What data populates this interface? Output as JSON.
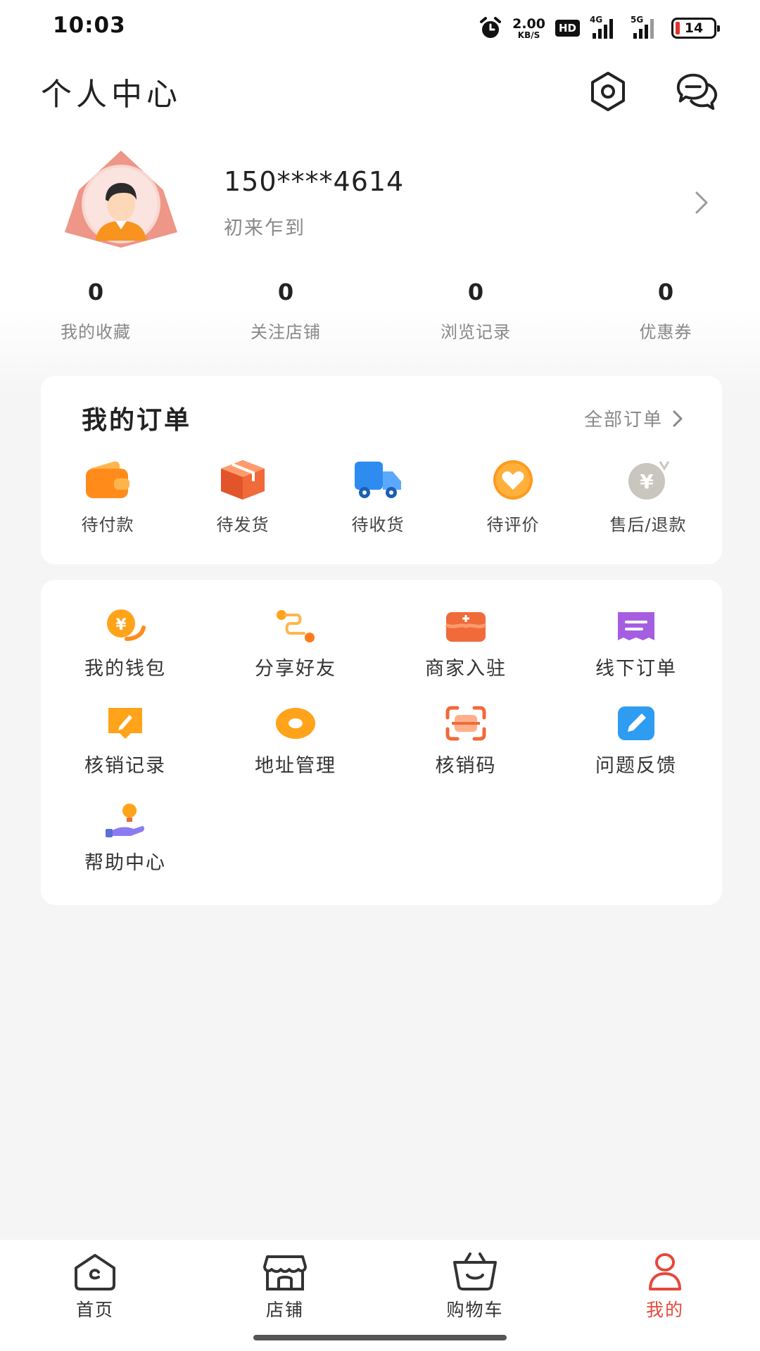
{
  "status_bar": {
    "time": "10:03",
    "net_speed_value": "2.00",
    "net_speed_unit": "KB/S",
    "hd_label": "HD",
    "signal_1_label": "4G",
    "signal_2_label": "5G",
    "battery_level": "14",
    "battery_color": "#e0312c",
    "icons": [
      "alarm-icon",
      "signal-4g-icon",
      "signal-5g-icon",
      "battery-icon"
    ]
  },
  "header": {
    "title": "个人中心",
    "icons": [
      "settings-hexagon-icon",
      "message-chat-icon"
    ]
  },
  "profile": {
    "phone": "150****4614",
    "level": "初来乍到"
  },
  "stats": [
    {
      "value": "0",
      "label": "我的收藏"
    },
    {
      "value": "0",
      "label": "关注店铺"
    },
    {
      "value": "0",
      "label": "浏览记录"
    },
    {
      "value": "0",
      "label": "优惠券"
    }
  ],
  "orders": {
    "title": "我的订单",
    "all_link": "全部订单",
    "items": [
      {
        "label": "待付款",
        "icon": "wallet-icon"
      },
      {
        "label": "待发货",
        "icon": "package-icon"
      },
      {
        "label": "待收货",
        "icon": "delivery-truck-icon"
      },
      {
        "label": "待评价",
        "icon": "heart-icon"
      },
      {
        "label": "售后/退款",
        "icon": "refund-coin-icon"
      }
    ]
  },
  "services": [
    {
      "label": "我的钱包",
      "icon": "wallet-coin-icon"
    },
    {
      "label": "分享好友",
      "icon": "share-route-icon"
    },
    {
      "label": "商家入驻",
      "icon": "merchant-box-icon"
    },
    {
      "label": "线下订单",
      "icon": "ticket-icon"
    },
    {
      "label": "核销记录",
      "icon": "edit-record-icon"
    },
    {
      "label": "地址管理",
      "icon": "location-ring-icon"
    },
    {
      "label": "核销码",
      "icon": "scan-code-icon"
    },
    {
      "label": "问题反馈",
      "icon": "feedback-pen-icon"
    },
    {
      "label": "帮助中心",
      "icon": "help-lightbulb-icon"
    }
  ],
  "bottom_nav": [
    {
      "label": "首页",
      "icon": "home-icon"
    },
    {
      "label": "店铺",
      "icon": "store-icon"
    },
    {
      "label": "购物车",
      "icon": "shopping-basket-icon"
    },
    {
      "label": "我的",
      "icon": "profile-icon",
      "active": true
    }
  ],
  "colors": {
    "accent": "#e5483d",
    "orange": "#ff8c1a",
    "background": "#f5f5f5"
  }
}
